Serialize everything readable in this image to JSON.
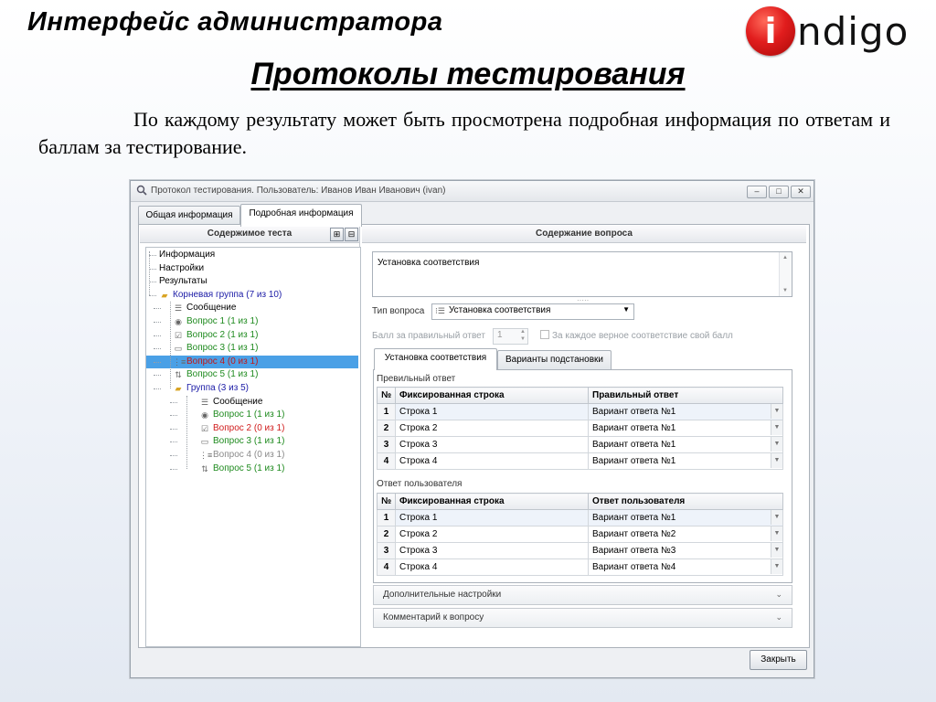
{
  "slide": {
    "title": "Интерфейс администратора",
    "subtitle": "Протоколы тестирования",
    "description": "По каждому результату может быть просмотрена подробная информация по ответам и баллам за тестирование.",
    "logo_letter": "i",
    "logo_word": "ndigo",
    "logo_color": "#e11d1d"
  },
  "window": {
    "title": "Протокол тестирования. Пользователь: Иванов Иван Иванович (ivan)",
    "controls": {
      "minimize": "–",
      "maximize": "□",
      "close": "✕"
    },
    "tabs": [
      {
        "label": "Общая информация",
        "active": false
      },
      {
        "label": "Подробная информация",
        "active": true
      }
    ],
    "close_label": "Закрыть"
  },
  "left_panel": {
    "header": "Содержимое теста",
    "tree": [
      {
        "label": "Информация",
        "icon": "none",
        "color": "#000000"
      },
      {
        "label": "Настройки",
        "icon": "none",
        "color": "#000000"
      },
      {
        "label": "Результаты",
        "icon": "none",
        "color": "#000000"
      },
      {
        "label": "Корневая группа (7 из 10)",
        "icon": "folder-icon",
        "color": "#1a1aa6"
      },
      {
        "label": "Сообщение",
        "icon": "message-icon",
        "color": "#000000"
      },
      {
        "label": "Вопрос 1 (1 из 1)",
        "icon": "radio-icon",
        "color": "#1e8a1e"
      },
      {
        "label": "Вопрос 2 (1 из 1)",
        "icon": "checkbox-icon",
        "color": "#1e8a1e"
      },
      {
        "label": "Вопрос 3 (1 из 1)",
        "icon": "textfield-icon",
        "color": "#1e8a1e"
      },
      {
        "label": "Вопрос 4 (0 из 1)",
        "icon": "matching-icon",
        "color": "#d01c1c",
        "selected": true
      },
      {
        "label": "Вопрос 5 (1 из 1)",
        "icon": "ordering-icon",
        "color": "#1e8a1e"
      },
      {
        "label": "Группа (3 из 5)",
        "icon": "folder-icon",
        "color": "#1a1aa6"
      },
      {
        "label": "Сообщение",
        "icon": "message-icon",
        "color": "#000000"
      },
      {
        "label": "Вопрос 1 (1 из 1)",
        "icon": "radio-icon",
        "color": "#1e8a1e"
      },
      {
        "label": "Вопрос 2 (0 из 1)",
        "icon": "checkbox-icon",
        "color": "#d01c1c"
      },
      {
        "label": "Вопрос 3 (1 из 1)",
        "icon": "textfield-icon",
        "color": "#1e8a1e"
      },
      {
        "label": "Вопрос 4 (0 из 1)",
        "icon": "matching-icon",
        "color": "#8a8a8a"
      },
      {
        "label": "Вопрос 5 (1 из 1)",
        "icon": "ordering-icon",
        "color": "#1e8a1e"
      }
    ]
  },
  "right_panel": {
    "header": "Содержание вопроса",
    "question_text": "Установка соответствия",
    "question_type_label": "Тип вопроса",
    "question_type_value": "Установка соответствия",
    "score_label": "Балл за правильный ответ",
    "score_value": "1",
    "score_each_label": "За каждое верное соответствие свой балл",
    "inner_tabs": [
      {
        "label": "Установка соответствия",
        "active": true
      },
      {
        "label": "Варианты подстановки",
        "active": false
      }
    ],
    "correct_section": "Превильный ответ",
    "correct_headers": [
      "№",
      "Фиксированная строка",
      "Правильный ответ"
    ],
    "correct_rows": [
      [
        "1",
        "Строка 1",
        "Вариант ответа №1"
      ],
      [
        "2",
        "Строка 2",
        "Вариант ответа №1"
      ],
      [
        "3",
        "Строка 3",
        "Вариант ответа №1"
      ],
      [
        "4",
        "Строка 4",
        "Вариант ответа №1"
      ]
    ],
    "user_section": "Ответ пользователя",
    "user_headers": [
      "№",
      "Фиксированная строка",
      "Ответ пользователя"
    ],
    "user_rows": [
      [
        "1",
        "Строка 1",
        "Вариант ответа №1"
      ],
      [
        "2",
        "Строка 2",
        "Вариант ответа №2"
      ],
      [
        "3",
        "Строка 3",
        "Вариант ответа №3"
      ],
      [
        "4",
        "Строка 4",
        "Вариант ответа №4"
      ]
    ],
    "extra_settings": "Дополнительные настройки",
    "comment": "Комментарий к вопросу"
  }
}
